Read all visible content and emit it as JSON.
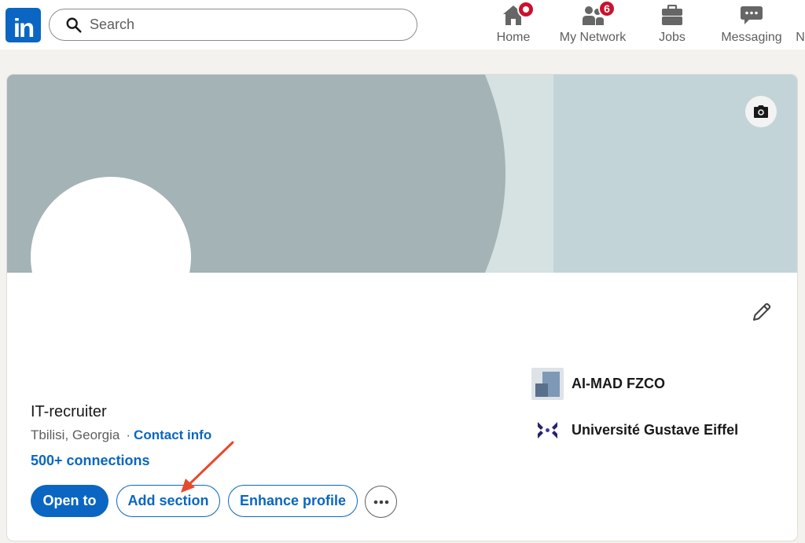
{
  "nav": {
    "logo_text": "in",
    "search": {
      "placeholder": "Search"
    },
    "items": [
      {
        "label": "Home",
        "icon": "home-icon",
        "badge": ""
      },
      {
        "label": "My Network",
        "icon": "network-icon",
        "badge": "6"
      },
      {
        "label": "Jobs",
        "icon": "briefcase-icon",
        "badge": ""
      },
      {
        "label": "Messaging",
        "icon": "messaging-icon",
        "badge": ""
      },
      {
        "label": "N",
        "icon": "",
        "badge": ""
      }
    ]
  },
  "profile": {
    "headline": "IT-recruiter",
    "location": "Tbilisi, Georgia",
    "separator": "·",
    "contact_info": "Contact info",
    "connections": "500+ connections",
    "buttons": {
      "open_to": "Open to",
      "add_section": "Add section",
      "enhance_profile": "Enhance profile"
    },
    "organizations": [
      {
        "name": "AI-MAD FZCO",
        "icon": "company-logo"
      },
      {
        "name": "Université Gustave Eiffel",
        "icon": "university-logo"
      }
    ]
  },
  "colors": {
    "brand": "#0a66c2",
    "badge": "#cb112d",
    "banner_dark": "#a3b3b6",
    "banner_light": "#d6e1e1",
    "banner_right": "#c3d4d8",
    "annotation_arrow": "#e8492c"
  }
}
